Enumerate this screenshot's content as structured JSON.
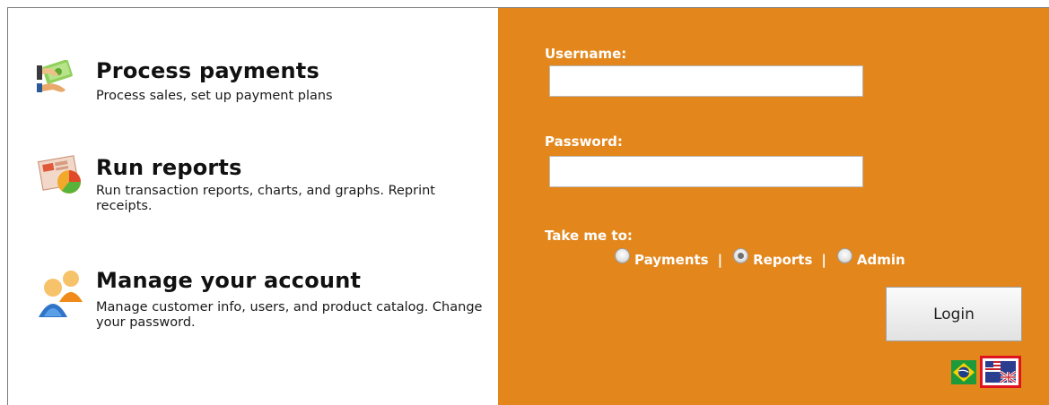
{
  "features": [
    {
      "title": "Process payments",
      "description": "Process sales, set up payment plans",
      "icon": "payments-icon"
    },
    {
      "title": "Run reports",
      "description": "Run transaction reports, charts, and graphs. Reprint receipts.",
      "icon": "reports-icon"
    },
    {
      "title": "Manage your account",
      "description": "Manage customer info, users, and product catalog. Change your password.",
      "icon": "account-users-icon"
    }
  ],
  "login": {
    "username_label": "Username:",
    "username_value": "",
    "password_label": "Password:",
    "password_value": "",
    "take_me_to_label": "Take me to:",
    "destinations": [
      {
        "label": "Payments",
        "selected": false
      },
      {
        "label": "Reports",
        "selected": true
      },
      {
        "label": "Admin",
        "selected": false
      }
    ],
    "separator": "|",
    "button_label": "Login"
  },
  "languages": [
    {
      "name": "brazil-flag-icon",
      "selected": false
    },
    {
      "name": "uk-flag-icon",
      "selected": true
    }
  ],
  "colors": {
    "panel": "#e3861b",
    "selected_language_border": "#e0141e"
  }
}
